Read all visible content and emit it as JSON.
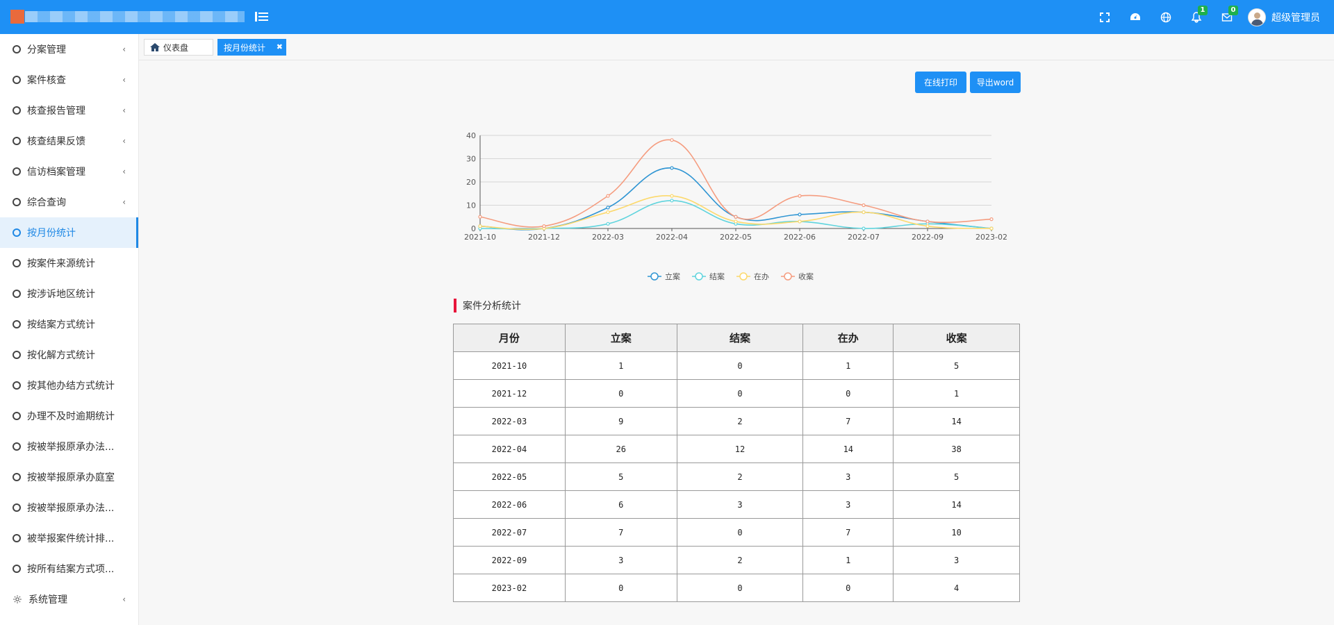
{
  "header": {
    "user_name": "超级管理员",
    "notifications_badge": "1",
    "messages_badge": "0",
    "icons": [
      "fullscreen-icon",
      "dashboard-icon",
      "globe-icon",
      "notification-icon",
      "mail-icon"
    ],
    "brand_color": "#1e90f5"
  },
  "sidebar": {
    "items": [
      {
        "label": "分案管理",
        "has_arrow": true
      },
      {
        "label": "案件核查",
        "has_arrow": true
      },
      {
        "label": "核查报告管理",
        "has_arrow": true
      },
      {
        "label": "核查结果反馈",
        "has_arrow": true
      },
      {
        "label": "信访档案管理",
        "has_arrow": true
      },
      {
        "label": "综合查询",
        "has_arrow": true
      },
      {
        "label": "按月份统计",
        "active": true
      },
      {
        "label": "按案件来源统计"
      },
      {
        "label": "按涉诉地区统计"
      },
      {
        "label": "按结案方式统计"
      },
      {
        "label": "按化解方式统计"
      },
      {
        "label": "按其他办结方式统计"
      },
      {
        "label": "办理不及时逾期统计"
      },
      {
        "label": "按被举报原承办法..."
      },
      {
        "label": "按被举报原承办庭室"
      },
      {
        "label": "按被举报原承办法..."
      },
      {
        "label": "被举报案件统计排..."
      },
      {
        "label": "按所有结案方式项..."
      },
      {
        "label": "系统管理",
        "has_arrow": true
      }
    ],
    "arrow_glyph": "‹"
  },
  "tabs": {
    "home_label": "仪表盘",
    "active_label": "按月份统计",
    "close_glyph": "✖"
  },
  "toolbar": {
    "print_label": "在线打印",
    "export_label": "导出word"
  },
  "chart_data": {
    "type": "line",
    "smooth": true,
    "categories": [
      "2021-10",
      "2021-12",
      "2022-03",
      "2022-04",
      "2022-05",
      "2022-06",
      "2022-07",
      "2022-09",
      "2023-02"
    ],
    "ylim": [
      0,
      40
    ],
    "yticks": [
      0,
      10,
      20,
      30,
      40
    ],
    "grid": true,
    "legend_position": "bottom",
    "series": [
      {
        "name": "立案",
        "color": "#2f95d3",
        "values": [
          1,
          0,
          9,
          26,
          5,
          6,
          7,
          3,
          0
        ]
      },
      {
        "name": "结案",
        "color": "#5fd4dd",
        "values": [
          0,
          0,
          2,
          12,
          2,
          3,
          0,
          2,
          0
        ]
      },
      {
        "name": "在办",
        "color": "#fcd96c",
        "values": [
          1,
          0,
          7,
          14,
          3,
          3,
          7,
          1,
          0
        ]
      },
      {
        "name": "收案",
        "color": "#f59c7f",
        "values": [
          5,
          1,
          14,
          38,
          5,
          14,
          10,
          3,
          4
        ]
      }
    ]
  },
  "section_title": "案件分析统计",
  "table": {
    "headers": [
      "月份",
      "立案",
      "结案",
      "在办",
      "收案"
    ],
    "rows": [
      [
        "2021-10",
        "1",
        "0",
        "1",
        "5"
      ],
      [
        "2021-12",
        "0",
        "0",
        "0",
        "1"
      ],
      [
        "2022-03",
        "9",
        "2",
        "7",
        "14"
      ],
      [
        "2022-04",
        "26",
        "12",
        "14",
        "38"
      ],
      [
        "2022-05",
        "5",
        "2",
        "3",
        "5"
      ],
      [
        "2022-06",
        "6",
        "3",
        "3",
        "14"
      ],
      [
        "2022-07",
        "7",
        "0",
        "7",
        "10"
      ],
      [
        "2022-09",
        "3",
        "2",
        "1",
        "3"
      ],
      [
        "2023-02",
        "0",
        "0",
        "0",
        "4"
      ]
    ]
  }
}
